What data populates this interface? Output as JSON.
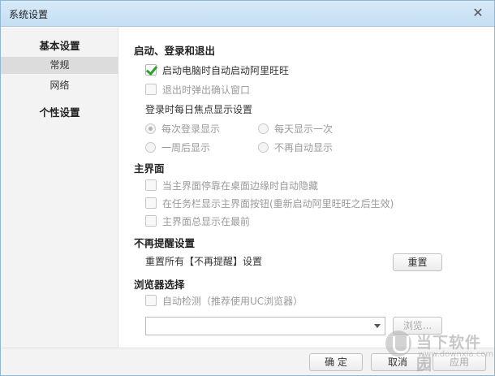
{
  "window": {
    "title": "系统设置",
    "close_glyph": "✕"
  },
  "sidebar": {
    "groups": [
      {
        "label": "基本设置",
        "items": [
          {
            "label": "常规",
            "active": true
          },
          {
            "label": "网络",
            "active": false
          }
        ]
      },
      {
        "label": "个性设置",
        "items": []
      }
    ]
  },
  "startup": {
    "title": "启动、登录和退出",
    "auto_start": {
      "label": "启动电脑时自动启动阿里旺旺",
      "checked": true
    },
    "confirm_exit": {
      "label": "退出时弹出确认窗口",
      "checked": false
    },
    "daily_focus_label": "登录时每日焦点显示设置",
    "radios": [
      {
        "label": "每次登录显示",
        "checked": true
      },
      {
        "label": "每天显示一次",
        "checked": false
      },
      {
        "label": "一周后显示",
        "checked": false
      },
      {
        "label": "不再自动显示",
        "checked": false
      }
    ]
  },
  "main_ui": {
    "title": "主界面",
    "options": [
      {
        "label": "当主界面停靠在桌面边缘时自动隐藏",
        "checked": false
      },
      {
        "label": "在任务栏显示主界面按钮(重新启动阿里旺旺之后生效)",
        "checked": false
      },
      {
        "label": "主界面总显示在最前",
        "checked": false
      }
    ]
  },
  "reminder": {
    "title": "不再提醒设置",
    "reset_text": "重置所有【不再提醒】设置",
    "reset_button": "重置"
  },
  "browser": {
    "title": "浏览器选择",
    "auto_detect": {
      "label": "自动检测（推荐使用UC浏览器）",
      "checked": false
    },
    "combo_value": "",
    "browse_button": "浏览..."
  },
  "footer": {
    "ok": "确 定",
    "cancel": "取消",
    "apply": "应用"
  },
  "watermark": {
    "line1": "当下软件园",
    "line2": "www.downxia.com"
  },
  "colors": {
    "title_bar": "#c4def3",
    "sidebar_bg": "#f3f3f3",
    "check_green": "#2ea12e"
  },
  "icons": {
    "close": "close-icon",
    "combo_arrow": "chevron-down-icon",
    "check": "checkmark-icon"
  }
}
